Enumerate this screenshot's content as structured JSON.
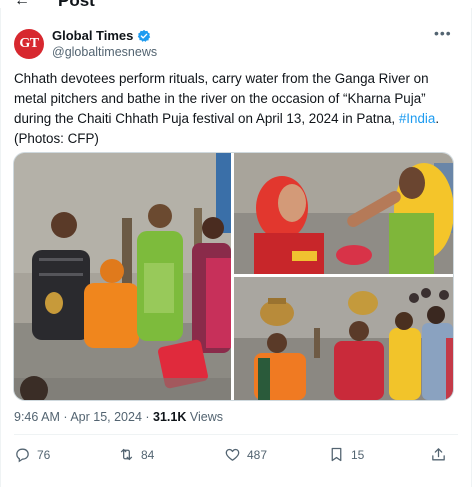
{
  "header": {
    "back_icon": "back-arrow-icon",
    "title": "Post"
  },
  "author": {
    "avatar_text": "GT",
    "name": "Global Times",
    "handle": "@globaltimesnews",
    "verified": true,
    "brand_color": "#d7282f"
  },
  "tweet": {
    "text_main": "Chhath devotees perform rituals, carry water from the Ganga River on metal pitchers and bathe in the river on the occasion of “Kharna Puja” during the Chaiti Chhath Puja festival on April 13, 2024 in Patna, ",
    "hashtag": "#India",
    "text_end": ". (Photos: CFP)"
  },
  "meta": {
    "time": "9:46 AM",
    "date": "Apr 15, 2024",
    "views_count": "31.1K",
    "views_label": "Views"
  },
  "actions": {
    "replies": "76",
    "reposts": "84",
    "likes": "487",
    "bookmarks": "15"
  },
  "colors": {
    "link": "#1d9bf0",
    "secondary_text": "#536471"
  }
}
